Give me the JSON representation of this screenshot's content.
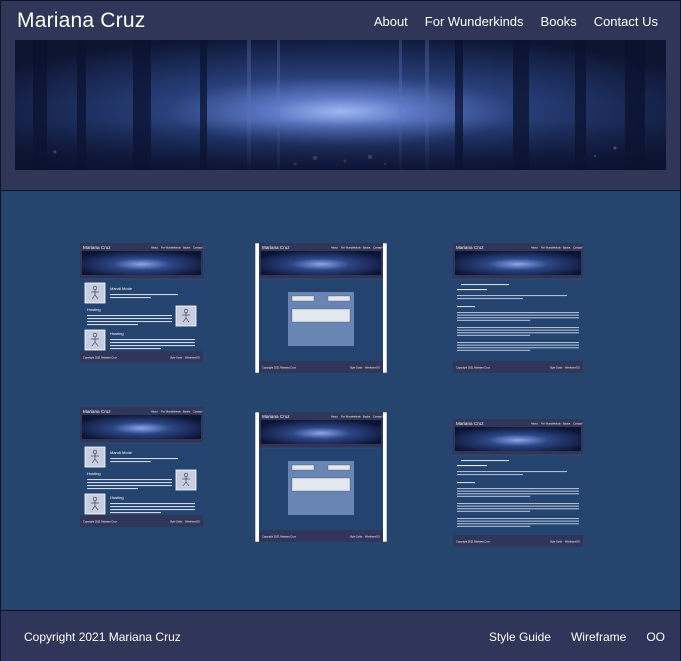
{
  "header": {
    "title": "Mariana Cruz",
    "nav": [
      "About",
      "For Wunderkinds",
      "Books",
      "Contact Us"
    ]
  },
  "banner": {
    "image": "misty-blue-forest"
  },
  "thumbnails": {
    "site_title": "Mariana Cruz",
    "nav": [
      "About",
      "For Wunderkinds",
      "Books",
      "Contact Us"
    ],
    "headings": [
      "Mandi Mode",
      "Hosting",
      "Hosting"
    ],
    "copyright": "Copyright 2021 Mariana Cruz",
    "footer_links": [
      "Style Guide",
      "Wireframe",
      "OO"
    ]
  },
  "footer": {
    "copyright": "Copyright 2021 Mariana Cruz",
    "links": [
      "Style Guide",
      "Wireframe",
      "OO"
    ]
  },
  "colors": {
    "header_bg": "#2f3657",
    "main_bg": "#25456f",
    "footer_bg": "#30355a",
    "text": "#ffffff"
  }
}
